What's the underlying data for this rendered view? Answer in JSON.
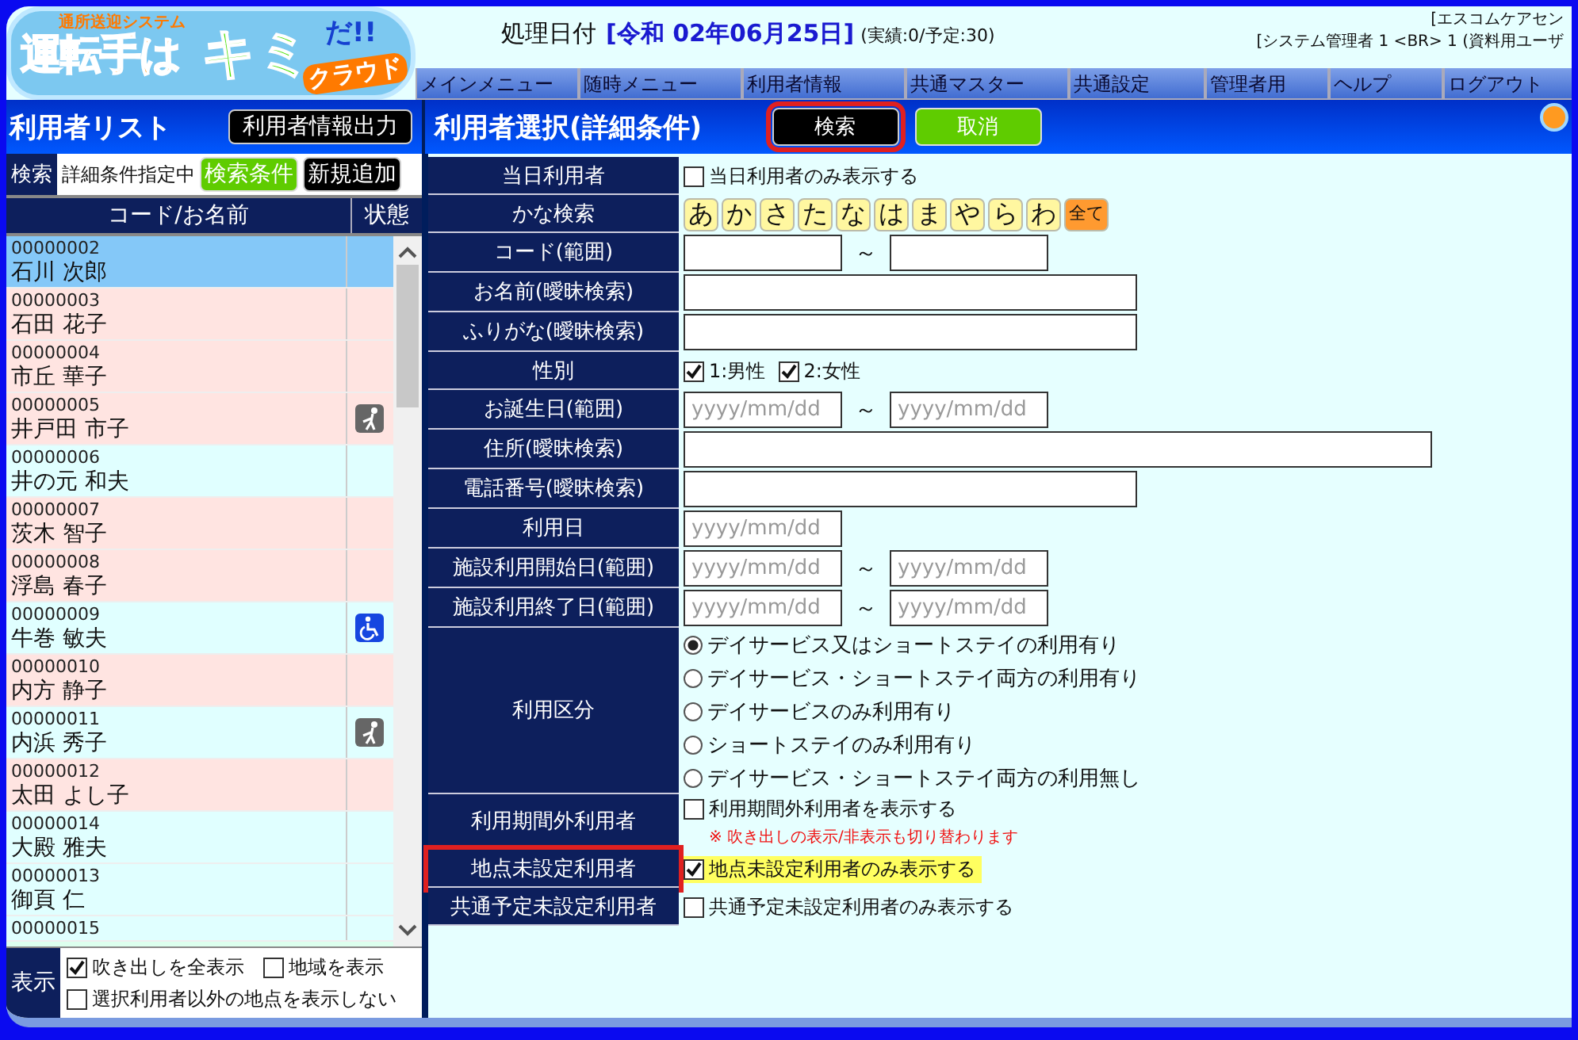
{
  "logo": {
    "tagline": "通所送迎システム",
    "title_main": "運転手は",
    "title_accent": "キミ",
    "title_end": "だ!!",
    "subtitle": "クラウド"
  },
  "header": {
    "date_label": "処理日付",
    "date_value": "[令和 02年06月25日]",
    "counts": "(実績:0/予定:30)",
    "office": "[エスコムケアセン",
    "user": "[システム管理者 1 <BR> 1 (資料用ユーザ"
  },
  "menu": [
    "メインメニュー",
    "随時メニュー",
    "利用者情報",
    "共通マスター",
    "共通設定",
    "管理者用",
    "ヘルプ",
    "ログアウト"
  ],
  "user_list": {
    "title": "利用者リスト",
    "export_button": "利用者情報出力",
    "search_label": "検索",
    "search_status": "詳細条件指定中",
    "condition_button": "検索条件",
    "add_button": "新規追加",
    "columns": [
      "コード/お名前",
      "状態"
    ],
    "rows": [
      {
        "code": "00000002",
        "name": "石川 次郎",
        "selected": true
      },
      {
        "code": "00000003",
        "name": "石田 花子",
        "selected": false,
        "color": "#ffe4e1"
      },
      {
        "code": "00000004",
        "name": "市丘 華子",
        "selected": false,
        "color": "#ffe4e1"
      },
      {
        "code": "00000005",
        "name": "井戸田 市子",
        "selected": false,
        "color": "#ffe4e1",
        "kind": "walker"
      },
      {
        "code": "00000006",
        "name": "井の元 和夫",
        "selected": false,
        "color": "#e0ffff"
      },
      {
        "code": "00000007",
        "name": "茨木 智子",
        "selected": false,
        "color": "#ffe4e1"
      },
      {
        "code": "00000008",
        "name": "浮島 春子",
        "selected": false,
        "color": "#ffe4e1"
      },
      {
        "code": "00000009",
        "name": "牛巻 敏夫",
        "selected": false,
        "color": "#e0ffff",
        "kind": "wheelchair"
      },
      {
        "code": "00000010",
        "name": "内方 静子",
        "selected": false,
        "color": "#ffe4e1"
      },
      {
        "code": "00000011",
        "name": "内浜 秀子",
        "selected": false,
        "color": "#e0ffff",
        "kind": "walker"
      },
      {
        "code": "00000012",
        "name": "太田 よし子",
        "selected": false,
        "color": "#ffe4e1"
      },
      {
        "code": "00000014",
        "name": "大殿 雅夫",
        "selected": false,
        "color": "#e0ffff"
      },
      {
        "code": "00000013",
        "name": "御頁 仁",
        "selected": false,
        "color": "#e0ffff"
      },
      {
        "code": "00000015",
        "selected": false,
        "color": "#e0ffff"
      }
    ],
    "display_label": "表示",
    "display_options": [
      {
        "label": "吹き出しを全表示",
        "checked": true
      },
      {
        "label": "地域を表示",
        "checked": false
      },
      {
        "label": "選択利用者以外の地点を表示しない",
        "checked": false
      }
    ]
  },
  "search_panel": {
    "title": "利用者選択(詳細条件)",
    "search_button": {
      "label": "検索",
      "highlighted": true
    },
    "cancel_button": "取消",
    "fields": [
      {
        "kind": "checkbox",
        "label": "当日利用者",
        "options": [
          {
            "label": "当日利用者のみ表示する",
            "checked": false
          }
        ]
      },
      {
        "kind": "kana",
        "label": "かな検索",
        "keys": [
          {
            "label": "あ",
            "kind": "kana"
          },
          {
            "label": "か",
            "kind": "kana"
          },
          {
            "label": "さ",
            "kind": "kana"
          },
          {
            "label": "た",
            "kind": "kana"
          },
          {
            "label": "な",
            "kind": "kana"
          },
          {
            "label": "は",
            "kind": "kana"
          },
          {
            "label": "ま",
            "kind": "kana"
          },
          {
            "label": "や",
            "kind": "kana"
          },
          {
            "label": "ら",
            "kind": "kana"
          },
          {
            "label": "わ",
            "kind": "kana"
          },
          {
            "label": "全て",
            "kind": "all"
          }
        ]
      },
      {
        "kind": "range",
        "label": "コード(範囲)",
        "separator": "～"
      },
      {
        "kind": "text",
        "label": "お名前(曖昧検索)"
      },
      {
        "kind": "text",
        "label": "ふりがな(曖昧検索)"
      },
      {
        "kind": "checkbox",
        "label": "性別",
        "options": [
          {
            "label": "1:男性",
            "checked": true
          },
          {
            "label": "2:女性",
            "checked": true
          }
        ]
      },
      {
        "kind": "range",
        "label": "お誕生日(範囲)",
        "placeholders": [
          "yyyy/mm/dd",
          "yyyy/mm/dd"
        ],
        "separator": "～"
      },
      {
        "kind": "wide",
        "label": "住所(曖昧検索)"
      },
      {
        "kind": "text",
        "label": "電話番号(曖昧検索)"
      },
      {
        "kind": "date",
        "label": "利用日",
        "placeholder": "yyyy/mm/dd"
      },
      {
        "kind": "range",
        "label": "施設利用開始日(範囲)",
        "placeholders": [
          "yyyy/mm/dd",
          "yyyy/mm/dd"
        ],
        "separator": "～"
      },
      {
        "kind": "range",
        "label": "施設利用終了日(範囲)",
        "placeholders": [
          "yyyy/mm/dd",
          "yyyy/mm/dd"
        ],
        "separator": "～"
      },
      {
        "kind": "radio",
        "label": "利用区分",
        "options": [
          {
            "label": "デイサービス又はショートステイの利用有り",
            "selected": true
          },
          {
            "label": "デイサービス・ショートステイ両方の利用有り",
            "selected": false
          },
          {
            "label": "デイサービスのみ利用有り",
            "selected": false
          },
          {
            "label": "ショートステイのみ利用有り",
            "selected": false
          },
          {
            "label": "デイサービス・ショートステイ両方の利用無し",
            "selected": false
          }
        ]
      },
      {
        "kind": "checkbox",
        "label": "利用期間外利用者",
        "options": [
          {
            "label": "利用期間外利用者を表示する",
            "checked": false
          }
        ],
        "note": "※ 吹き出しの表示/非表示も切り替わります"
      },
      {
        "kind": "checkbox",
        "label": "地点未設定利用者",
        "highlighted": true,
        "options": [
          {
            "label": "地点未設定利用者のみ表示する",
            "checked": true
          }
        ]
      },
      {
        "kind": "checkbox",
        "label": "共通予定未設定利用者",
        "options": [
          {
            "label": "共通予定未設定利用者のみ表示する",
            "checked": false
          }
        ]
      }
    ]
  }
}
